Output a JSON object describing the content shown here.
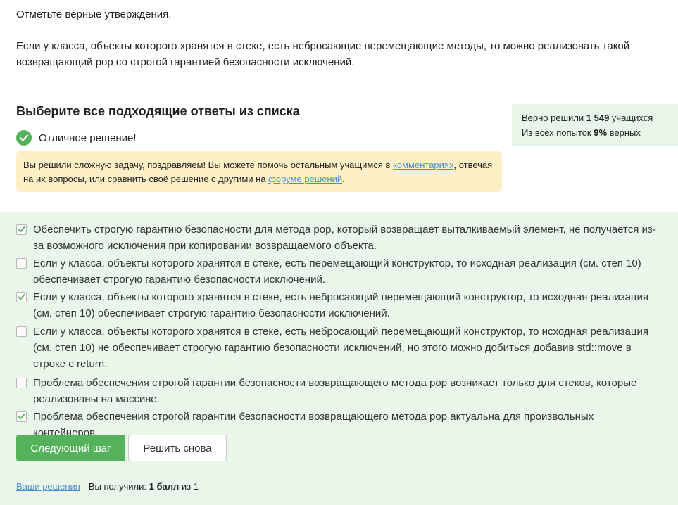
{
  "question": {
    "prompt": "Отметьте верные утверждения.",
    "statement": "Если у класса, объекты которого хранятся в стеке, есть небросающие перемещающие методы, то можно реализовать такой возвращающий pop со строгой гарантией безопасности исключений."
  },
  "section": {
    "title": "Выберите все подходящие ответы из списка",
    "success": "Отличное решение!"
  },
  "notice": {
    "text_1": "Вы решили сложную задачу, поздравляем! Вы можете помочь остальным учащимся в ",
    "link_comments": "комментариях",
    "text_2": ", отвечая на их вопросы, или сравнить своё решение с другими на ",
    "link_forum": "форуме решений",
    "text_3": "."
  },
  "stats": {
    "solved_prefix": "Верно решили ",
    "solved_count": "1 549",
    "solved_suffix": " учащихся",
    "attempts_prefix": "Из всех попыток ",
    "attempts_percent": "9%",
    "attempts_suffix": " верных"
  },
  "options": [
    {
      "text": "Обеспечить строгую гарантию безопасности для метода pop, который возвращает выталкиваемый элемент, не получается из-за возможного исключения при копировании возвращаемого объекта.",
      "checked": true
    },
    {
      "text": "Если у класса, объекты которого хранятся в стеке, есть перемещающий конструктор, то исходная реализация (см. степ 10) обеспечивает строгую гарантию безопасности исключений.",
      "checked": false
    },
    {
      "text": "Если у класса, объекты которого хранятся в стеке, есть небросающий перемещающий конструктор, то исходная реализация (см. степ 10) обеспечивает строгую гарантию безопасности исключений.",
      "checked": true
    },
    {
      "text": "Если у класса, объекты которого хранятся в стеке, есть небросающий перемещающий конструктор, то исходная реализация (см. степ 10) не обеспечивает строгую гарантию безопасности исключений, но этого можно добиться добавив std::move в строке с return.",
      "checked": false
    },
    {
      "text": "Проблема обеспечения строгой гарантии безопасности возвращающего метода pop возникает только для стеков, которые реализованы на массиве.",
      "checked": false
    },
    {
      "text": "Проблема обеспечения строгой гарантии безопасности возвращающего метода pop актуальна для произвольных контейнеров.",
      "checked": true
    }
  ],
  "buttons": {
    "next": "Следующий шаг",
    "retry": "Решить снова"
  },
  "footer": {
    "link": "Ваши решения",
    "score_prefix": "Вы получили: ",
    "score_value": "1 балл",
    "score_suffix": " из 1"
  },
  "colors": {
    "accent_green": "#54b25a",
    "answers_bg": "#e9f6e9",
    "notice_bg": "#fdefc6",
    "link": "#4a8ed6"
  }
}
